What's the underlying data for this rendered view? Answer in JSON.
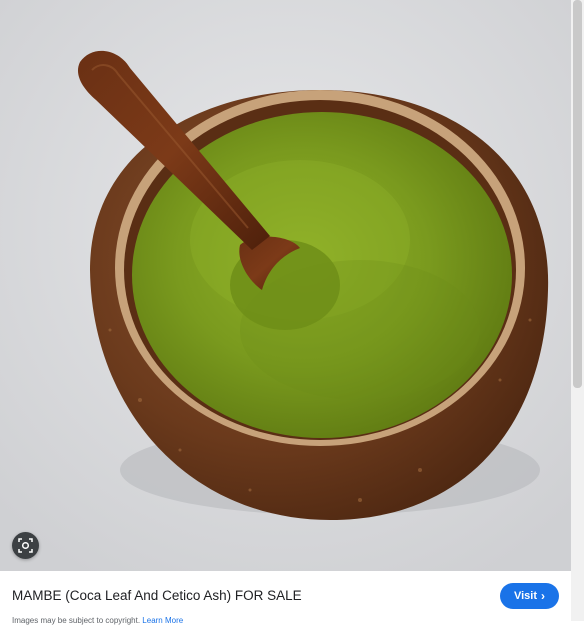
{
  "image": {
    "description_icon": "magnify-lens-icon"
  },
  "caption": {
    "title": "MAMBE (Coca Leaf And Cetico Ash) FOR SALE",
    "visit_label": "Visit",
    "visit_icon": "chevron-right-icon",
    "copyright_text": "Images may be subject to copyright.",
    "learn_more": "Learn More"
  },
  "colors": {
    "accent": "#1a73e8",
    "powder": "#7a9a1e",
    "bowl": "#6b3a1c"
  }
}
